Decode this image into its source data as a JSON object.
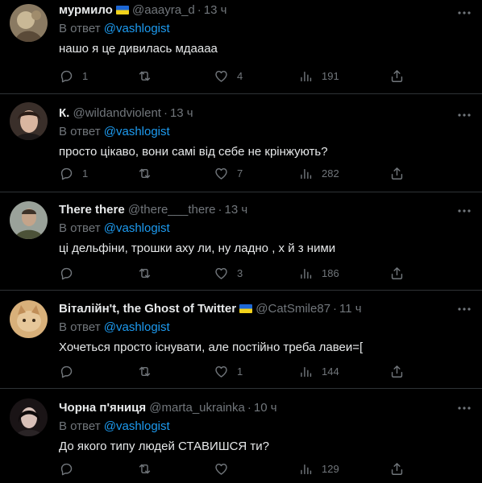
{
  "colors": {
    "background": "#000000",
    "text": "#e7e9ea",
    "muted": "#71767b",
    "link": "#1d9bf0",
    "divider": "#2f3336"
  },
  "icons": {
    "reply": "reply-icon",
    "retweet": "retweet-icon",
    "like": "heart-icon",
    "views": "views-icon",
    "share": "share-icon",
    "more": "more-icon"
  },
  "tweets": [
    {
      "name": "мурмило",
      "flag": true,
      "handle": "@aaayra_d",
      "dot": "·",
      "time": "13 ч",
      "reply_prefix": "В ответ",
      "reply_mention": "@vashlogist",
      "text": "нашо я це дивилась мдаааа",
      "replies": "1",
      "retweets": "",
      "likes": "4",
      "views": "191"
    },
    {
      "name": "К.",
      "flag": false,
      "handle": "@wildandviolent",
      "dot": "·",
      "time": "13 ч",
      "reply_prefix": "В ответ",
      "reply_mention": "@vashlogist",
      "text": "просто цікаво, вони самі від себе не крінжують?",
      "replies": "1",
      "retweets": "",
      "likes": "7",
      "views": "282"
    },
    {
      "name": "There there",
      "flag": false,
      "handle": "@there___there",
      "dot": "·",
      "time": "13 ч",
      "reply_prefix": "В ответ",
      "reply_mention": "@vashlogist",
      "text": "ці дельфіни, трошки аху ли, ну ладно , х й з ними",
      "replies": "",
      "retweets": "",
      "likes": "3",
      "views": "186"
    },
    {
      "name": "Віталійн't, the Ghost of Twitter",
      "flag": true,
      "handle": "@CatSmile87",
      "dot": "·",
      "time": "11 ч",
      "reply_prefix": "В ответ",
      "reply_mention": "@vashlogist",
      "text": "Хочеться просто існувати, але постійно треба лавеи=[",
      "replies": "",
      "retweets": "",
      "likes": "1",
      "views": "144"
    },
    {
      "name": "Чорна п'яниця",
      "flag": false,
      "handle": "@marta_ukrainka",
      "dot": "·",
      "time": "10 ч",
      "reply_prefix": "В ответ",
      "reply_mention": "@vashlogist",
      "text": "До якого типу людей СТАВИШСЯ ти?",
      "replies": "",
      "retweets": "",
      "likes": "",
      "views": "129"
    }
  ]
}
